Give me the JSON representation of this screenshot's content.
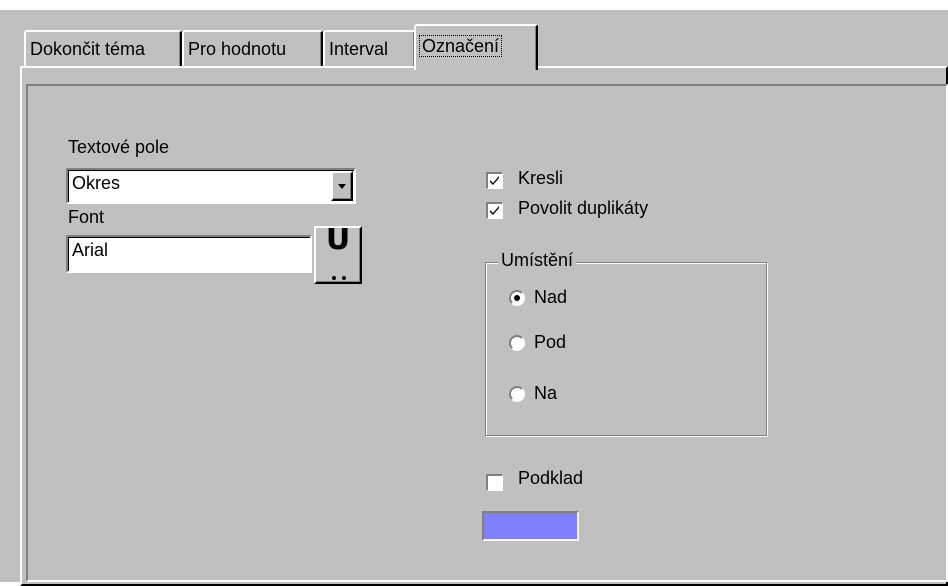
{
  "tabs": [
    {
      "label": "Dokončit téma",
      "active": false
    },
    {
      "label": "Pro hodnotu",
      "active": false
    },
    {
      "label": "Interval",
      "active": false
    },
    {
      "label": "Označení",
      "active": true
    }
  ],
  "text_field": {
    "label": "Textové pole",
    "value": "Okres"
  },
  "font": {
    "label": "Font",
    "value": "Arial",
    "button_glyph": "U"
  },
  "draw": {
    "label": "Kresli",
    "checked": true
  },
  "duplicates": {
    "label": "Povolit duplikáty",
    "checked": true
  },
  "placement": {
    "title": "Umístění",
    "options": [
      {
        "label": "Nad",
        "selected": true
      },
      {
        "label": "Pod",
        "selected": false
      },
      {
        "label": "Na",
        "selected": false
      }
    ]
  },
  "background": {
    "label": "Podklad",
    "checked": false,
    "color": "#8080ff"
  }
}
